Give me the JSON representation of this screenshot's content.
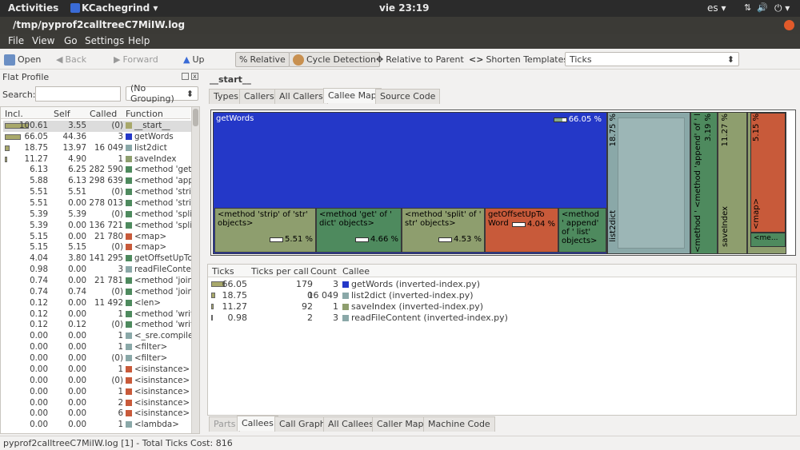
{
  "topbar": {
    "activities": "Activities",
    "app": "KCachegrind ▾",
    "clock": "vie 23:19",
    "lang": "es ▾",
    "power": "⏻ ▾"
  },
  "window": {
    "title": "/tmp/pyprof2calltreeC7MiIW.log"
  },
  "menu": [
    "File",
    "View",
    "Go",
    "Settings",
    "Help"
  ],
  "toolbar": {
    "open": "Open",
    "back": "Back",
    "forward": "Forward",
    "up": "Up",
    "relative": "Relative",
    "cycle": "Cycle Detection",
    "relparent": "Relative to Parent",
    "shorten": "Shorten Templates",
    "ticks": "Ticks"
  },
  "left": {
    "title": "Flat Profile",
    "search_label": "Search:",
    "grouping": "(No Grouping)",
    "cols": [
      "Incl.",
      "Self",
      "Called",
      "Function"
    ],
    "rows": [
      {
        "incl": "100.61",
        "self": "3.55",
        "called": "(0)",
        "fn": "__start__",
        "color": "#a8a86a",
        "sel": true,
        "bar": 1.0
      },
      {
        "incl": "66.05",
        "self": "44.36",
        "called": "3",
        "fn": "getWords",
        "color": "#2438c8",
        "bar": 0.66
      },
      {
        "incl": "18.75",
        "self": "13.97",
        "called": "16 049",
        "fn": "list2dict",
        "color": "#8aa8a8",
        "bar": 0.19
      },
      {
        "incl": "11.27",
        "self": "4.90",
        "called": "1",
        "fn": "saveIndex",
        "color": "#8e9e6e",
        "bar": 0.11
      },
      {
        "incl": "6.13",
        "self": "6.25",
        "called": "282 590",
        "fn": "<method 'get'",
        "color": "#4e8a5e"
      },
      {
        "incl": "5.88",
        "self": "6.13",
        "called": "298 639",
        "fn": "<method 'appe",
        "color": "#4e8a5e"
      },
      {
        "incl": "5.51",
        "self": "5.51",
        "called": "(0)",
        "fn": "<method 'strip",
        "color": "#4e8a5e"
      },
      {
        "incl": "5.51",
        "self": "0.00",
        "called": "278 013",
        "fn": "<method 'strip",
        "color": "#4e8a5e"
      },
      {
        "incl": "5.39",
        "self": "5.39",
        "called": "(0)",
        "fn": "<method 'split",
        "color": "#4e8a5e"
      },
      {
        "incl": "5.39",
        "self": "0.00",
        "called": "136 721",
        "fn": "<method 'split",
        "color": "#4e8a5e"
      },
      {
        "incl": "5.15",
        "self": "0.00",
        "called": "21 780",
        "fn": "<map>",
        "color": "#c85a3a"
      },
      {
        "incl": "5.15",
        "self": "5.15",
        "called": "(0)",
        "fn": "<map>",
        "color": "#c85a3a"
      },
      {
        "incl": "4.04",
        "self": "3.80",
        "called": "141 295",
        "fn": "getOffsetUpTo",
        "color": "#4e8a5e"
      },
      {
        "incl": "0.98",
        "self": "0.00",
        "called": "3",
        "fn": "readFileConte",
        "color": "#8aa8a8"
      },
      {
        "incl": "0.74",
        "self": "0.00",
        "called": "21 781",
        "fn": "<method 'join'",
        "color": "#4e8a5e"
      },
      {
        "incl": "0.74",
        "self": "0.74",
        "called": "(0)",
        "fn": "<method 'join'",
        "color": "#4e8a5e"
      },
      {
        "incl": "0.12",
        "self": "0.00",
        "called": "11 492",
        "fn": "<len>",
        "color": "#4e8a5e"
      },
      {
        "incl": "0.12",
        "self": "0.00",
        "called": "1",
        "fn": "<method 'writ",
        "color": "#4e8a5e"
      },
      {
        "incl": "0.12",
        "self": "0.12",
        "called": "(0)",
        "fn": "<method 'writ",
        "color": "#4e8a5e"
      },
      {
        "incl": "0.00",
        "self": "0.00",
        "called": "1",
        "fn": "<_sre.compile>",
        "color": "#8aa8a8"
      },
      {
        "incl": "0.00",
        "self": "0.00",
        "called": "1",
        "fn": "<filter>",
        "color": "#8aa8a8"
      },
      {
        "incl": "0.00",
        "self": "0.00",
        "called": "(0)",
        "fn": "<filter>",
        "color": "#8aa8a8"
      },
      {
        "incl": "0.00",
        "self": "0.00",
        "called": "1",
        "fn": "<isinstance>",
        "color": "#c85a3a"
      },
      {
        "incl": "0.00",
        "self": "0.00",
        "called": "(0)",
        "fn": "<isinstance>",
        "color": "#c85a3a"
      },
      {
        "incl": "0.00",
        "self": "0.00",
        "called": "1",
        "fn": "<isinstance>",
        "color": "#c85a3a"
      },
      {
        "incl": "0.00",
        "self": "0.00",
        "called": "2",
        "fn": "<isinstance>",
        "color": "#c85a3a"
      },
      {
        "incl": "0.00",
        "self": "0.00",
        "called": "6",
        "fn": "<isinstance>",
        "color": "#c85a3a"
      },
      {
        "incl": "0.00",
        "self": "0.00",
        "called": "1",
        "fn": "<lambda>",
        "color": "#8aa8a8"
      }
    ]
  },
  "right": {
    "fn_title": "__start__",
    "tabs_top": [
      "Types",
      "Callers",
      "All Callers",
      "Callee Map",
      "Source Code"
    ],
    "map": {
      "getWords": "getWords",
      "getWords_pct": "66.05 %",
      "strip": "<method 'strip' of 'str' objects>",
      "strip_pct": "5.51 %",
      "get": "<method 'get' of ' dict' objects>",
      "get_pct": "4.66 %",
      "split": "<method 'split' of ' str' objects>",
      "split_pct": "4.53 %",
      "offset": "getOffsetUpTo Word",
      "offset_pct": "4.04 %",
      "append": "<method ' append' of ' list' objects>",
      "list2dict": "list2dict",
      "list2dict_pct": "18.75 %",
      "mappend": "<method 'append' of ' list' objects>",
      "mappend_pct": "3.19 %",
      "mget": "<method ' get' of ' dict' o...",
      "saveIndex": "saveIndex",
      "saveIndex_pct": "11.27 %",
      "map": "<map>",
      "map_pct": "5.15 %",
      "me": "<me..."
    },
    "cols": [
      "Ticks",
      "Ticks per call",
      "Count",
      "Callee"
    ],
    "rows": [
      {
        "ticks": "66.05",
        "tpc": "179",
        "count": "3",
        "callee": "getWords (inverted-index.py)",
        "color": "#2438c8",
        "bar": 0.66
      },
      {
        "ticks": "18.75",
        "tpc": "0",
        "count": "16 049",
        "callee": "list2dict (inverted-index.py)",
        "color": "#8aa8a8",
        "bar": 0.19
      },
      {
        "ticks": "11.27",
        "tpc": "92",
        "count": "1",
        "callee": "saveIndex (inverted-index.py)",
        "color": "#8e9e6e",
        "bar": 0.11
      },
      {
        "ticks": "0.98",
        "tpc": "2",
        "count": "3",
        "callee": "readFileContent (inverted-index.py)",
        "color": "#8aa8a8",
        "bar": 0.01
      }
    ],
    "tabs_bottom": [
      "Parts",
      "Callees",
      "Call Graph",
      "All Callees",
      "Caller Map",
      "Machine Code"
    ]
  },
  "status": "pyprof2calltreeC7MiIW.log [1] - Total Ticks Cost: 816"
}
